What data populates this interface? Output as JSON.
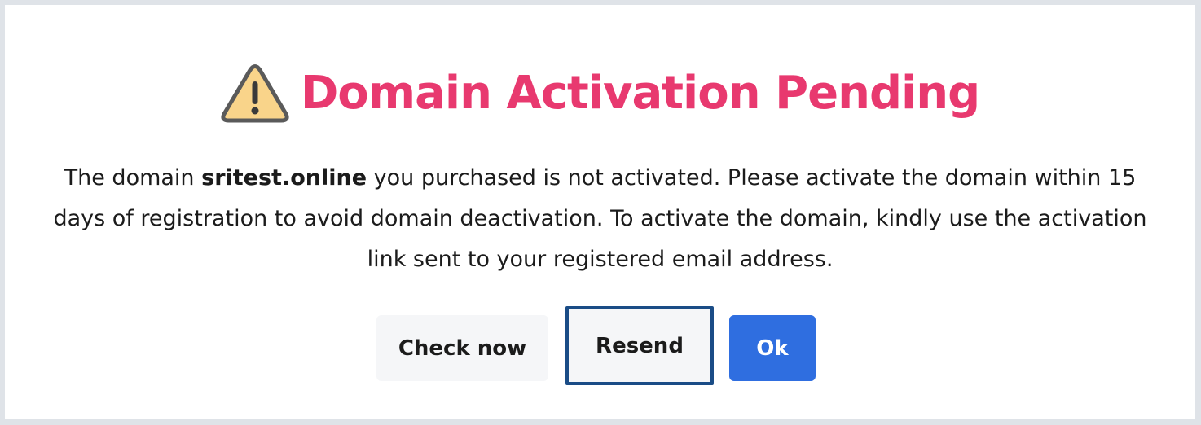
{
  "dialog": {
    "title": "Domain Activation Pending",
    "icon": "warning-icon",
    "message": {
      "before": "The domain ",
      "domain": "sritest.online",
      "after": " you purchased is not activated. Please activate the domain within 15 days of registration to avoid domain deactivation. To activate the domain, kindly use the activation link sent to your registered email address."
    },
    "buttons": {
      "check_now": "Check now",
      "resend": "Resend",
      "ok": "Ok"
    }
  },
  "colors": {
    "title": "#e8396f",
    "primary": "#2f6ee0",
    "focus_border": "#1a4c86",
    "warning_fill": "#f9d48a"
  }
}
